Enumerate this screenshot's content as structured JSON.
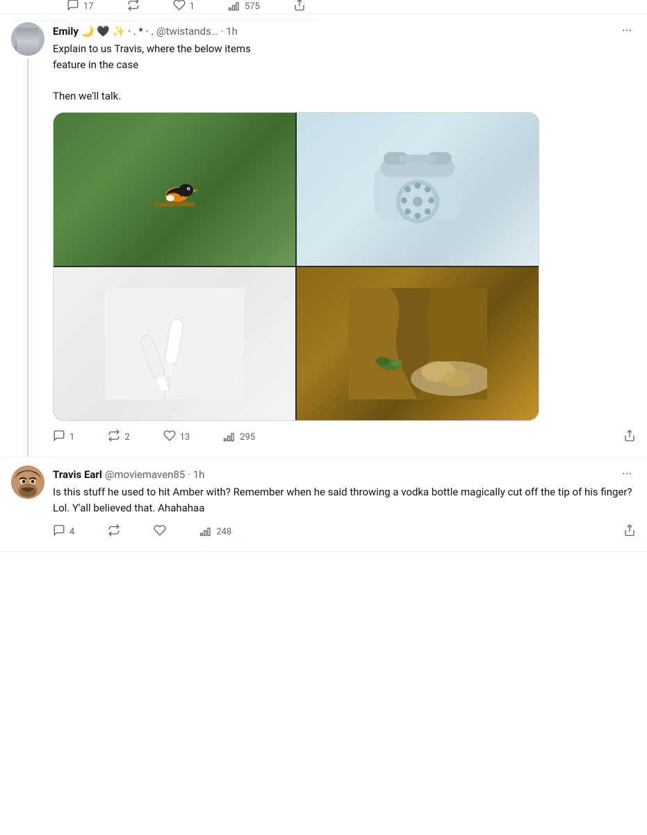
{
  "prev_tweet": {
    "reply_count": "17",
    "retweet_count": "",
    "like_count": "1",
    "views_count": "575",
    "share_label": "share"
  },
  "emily_tweet": {
    "display_name": "Emily",
    "decorations": "🌙 🖤 ✨ · . * · .",
    "username": "@twistands…",
    "time": "1h",
    "more_label": "···",
    "text_line1": "Explain to us Travis, where the below items",
    "text_line2": "feature in the case",
    "text_line3": "",
    "text_line4": "Then we'll talk.",
    "reply_count": "1",
    "retweet_count": "2",
    "like_count": "13",
    "views_count": "295"
  },
  "travis_tweet": {
    "display_name": "Travis Earl",
    "username": "@moviemaven85",
    "time": "1h",
    "more_label": "···",
    "text": "Is this stuff he used to hit Amber with? Remember when he said throwing a vodka bottle magically cut off the tip of his finger? Lol. Y'all believed that. Ahahahaa",
    "reply_count": "4",
    "retweet_count": "",
    "like_count": "",
    "views_count": "248"
  },
  "icons": {
    "reply": "💬",
    "retweet": "🔁",
    "like": "🤍",
    "views": "📊",
    "share": "📤"
  }
}
